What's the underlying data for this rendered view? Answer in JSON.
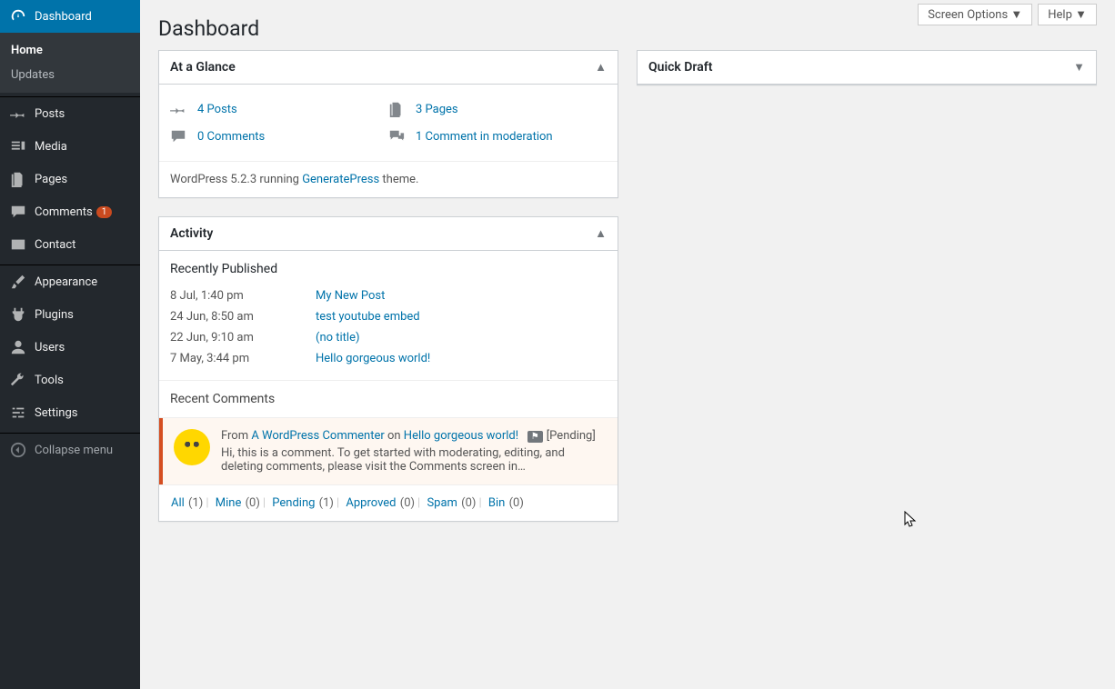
{
  "topButtons": {
    "screenOptions": "Screen Options",
    "help": "Help"
  },
  "pageTitle": "Dashboard",
  "sidebar": {
    "dashboard": "Dashboard",
    "home": "Home",
    "updates": "Updates",
    "posts": "Posts",
    "media": "Media",
    "pages": "Pages",
    "comments": "Comments",
    "commentsBadge": "1",
    "contact": "Contact",
    "appearance": "Appearance",
    "plugins": "Plugins",
    "users": "Users",
    "tools": "Tools",
    "settings": "Settings",
    "collapse": "Collapse menu"
  },
  "glance": {
    "title": "At a Glance",
    "posts": "4 Posts",
    "pages": "3 Pages",
    "comments": "0 Comments",
    "moderation": "1 Comment in moderation",
    "versionPrefix": "WordPress 5.2.3 running ",
    "theme": "GeneratePress",
    "versionSuffix": " theme."
  },
  "activity": {
    "title": "Activity",
    "recentlyPublished": "Recently Published",
    "items": [
      {
        "date": "8 Jul, 1:40 pm",
        "title": "My New Post"
      },
      {
        "date": "24 Jun, 8:50 am",
        "title": "test youtube embed"
      },
      {
        "date": "22 Jun, 9:10 am",
        "title": "(no title)"
      },
      {
        "date": "7 May, 3:44 pm",
        "title": "Hello gorgeous world!"
      }
    ],
    "recentComments": "Recent Comments",
    "comment": {
      "from": "From ",
      "author": "A WordPress Commenter",
      "on": " on ",
      "post": "Hello gorgeous world!",
      "pending": "[Pending]",
      "text": "Hi, this is a comment. To get started with moderating, editing, and deleting comments, please visit the Comments screen in…"
    },
    "filters": {
      "all": "All",
      "allCount": " (1)",
      "mine": "Mine",
      "mineCount": " (0)",
      "pending": "Pending",
      "pendingCount": " (1)",
      "approved": "Approved",
      "approvedCount": " (0)",
      "spam": "Spam",
      "spamCount": " (0)",
      "bin": "Bin",
      "binCount": " (0)"
    }
  },
  "quickDraft": {
    "title": "Quick Draft"
  }
}
